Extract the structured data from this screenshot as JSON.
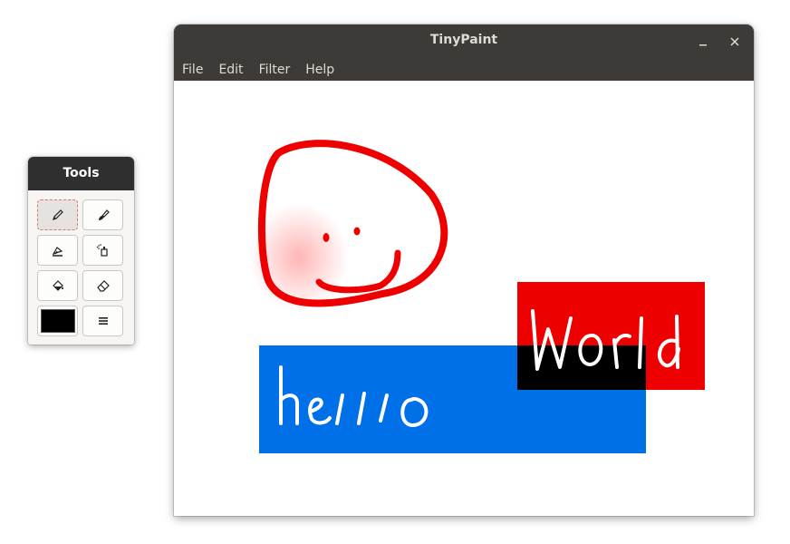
{
  "tools_panel": {
    "title": "Tools",
    "buttons": [
      {
        "name": "pencil-tool",
        "icon": "pencil-icon",
        "active": true
      },
      {
        "name": "brush-tool",
        "icon": "brush-icon",
        "active": false
      },
      {
        "name": "calligraphy-tool",
        "icon": "calligraphy-pen-icon",
        "active": false
      },
      {
        "name": "spray-tool",
        "icon": "spray-can-icon",
        "active": false
      },
      {
        "name": "fill-tool",
        "icon": "paint-bucket-icon",
        "active": false
      },
      {
        "name": "eraser-tool",
        "icon": "eraser-icon",
        "active": false
      },
      {
        "name": "color-picker",
        "color": "#000000"
      },
      {
        "name": "stroke-size-tool",
        "icon": "line-width-icon"
      }
    ]
  },
  "window": {
    "title": "TinyPaint",
    "minimize_icon": "minimize-icon",
    "close_icon": "close-icon",
    "menu": [
      "File",
      "Edit",
      "Filter",
      "Help"
    ]
  },
  "canvas": {
    "background": "#ffffff",
    "colors": {
      "red": "#ee0000",
      "blue": "#0070e8",
      "black": "#000000",
      "white": "#ffffff"
    },
    "drawing": "smiley face in red, blue rectangle with handwritten 'hello', red rectangle with handwritten 'World' partially overlapping in black"
  }
}
